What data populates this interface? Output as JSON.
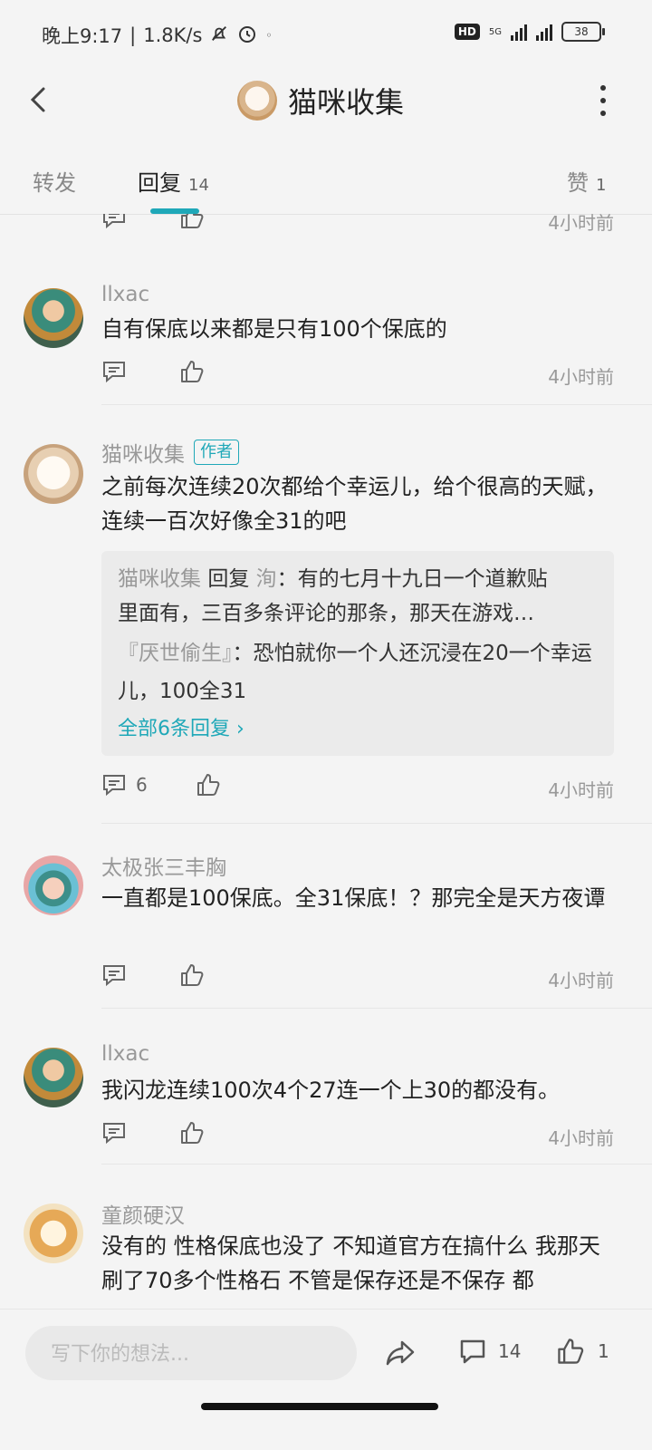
{
  "status": {
    "time": "晚上9:17",
    "speed": "1.8K/s",
    "hd": "HD",
    "network": "5G",
    "battery": "38"
  },
  "title": "猫咪收集",
  "tabs": [
    {
      "label": "转发",
      "count": ""
    },
    {
      "label": "回复",
      "count": "14"
    },
    {
      "label": "赞",
      "count": "1"
    }
  ],
  "partial_time": "4小时前",
  "comments": [
    {
      "user": "llxac",
      "text": "自有保底以来都是只有100个保底的",
      "time": "4小时前",
      "reply_count": ""
    },
    {
      "user": "猫咪收集",
      "author_badge": "作者",
      "text": "之前每次连续20次都给个幸运儿，给个很高的天赋，连续一百次好像全31的吧",
      "time": "4小时前",
      "reply_count": "6",
      "sub_replies": [
        {
          "name": "猫咪收集",
          "verb": "回复",
          "target": "洵",
          "text": "：有的七月十九日一个道歉贴里面有，三百多条评论的那条，那天在游戏…"
        },
        {
          "name": "『厌世偷生』",
          "text": "：恐怕就你一个人还沉浸在20一个幸运儿，100全31"
        }
      ],
      "all_replies": "全部6条回复"
    },
    {
      "user": "太极张三丰胸",
      "text": "一直都是100保底。全31保底！？那完全是天方夜谭",
      "time": "4小时前",
      "reply_count": ""
    },
    {
      "user": "llxac",
      "text": "我闪龙连续100次4个27连一个上30的都没有。",
      "time": "4小时前",
      "reply_count": ""
    },
    {
      "user": "童颜硬汉",
      "text": "没有的  性格保底也没了   不知道官方在搞什么  我那天刷了70多个性格石  不管是保存还是不保存  都",
      "time": "",
      "reply_count": ""
    }
  ],
  "bottom": {
    "placeholder": "写下你的想法...",
    "comment_count": "14",
    "like_count": "1"
  },
  "colors": {
    "accent": "#1fa8b8",
    "background": "#f4f4f4"
  }
}
